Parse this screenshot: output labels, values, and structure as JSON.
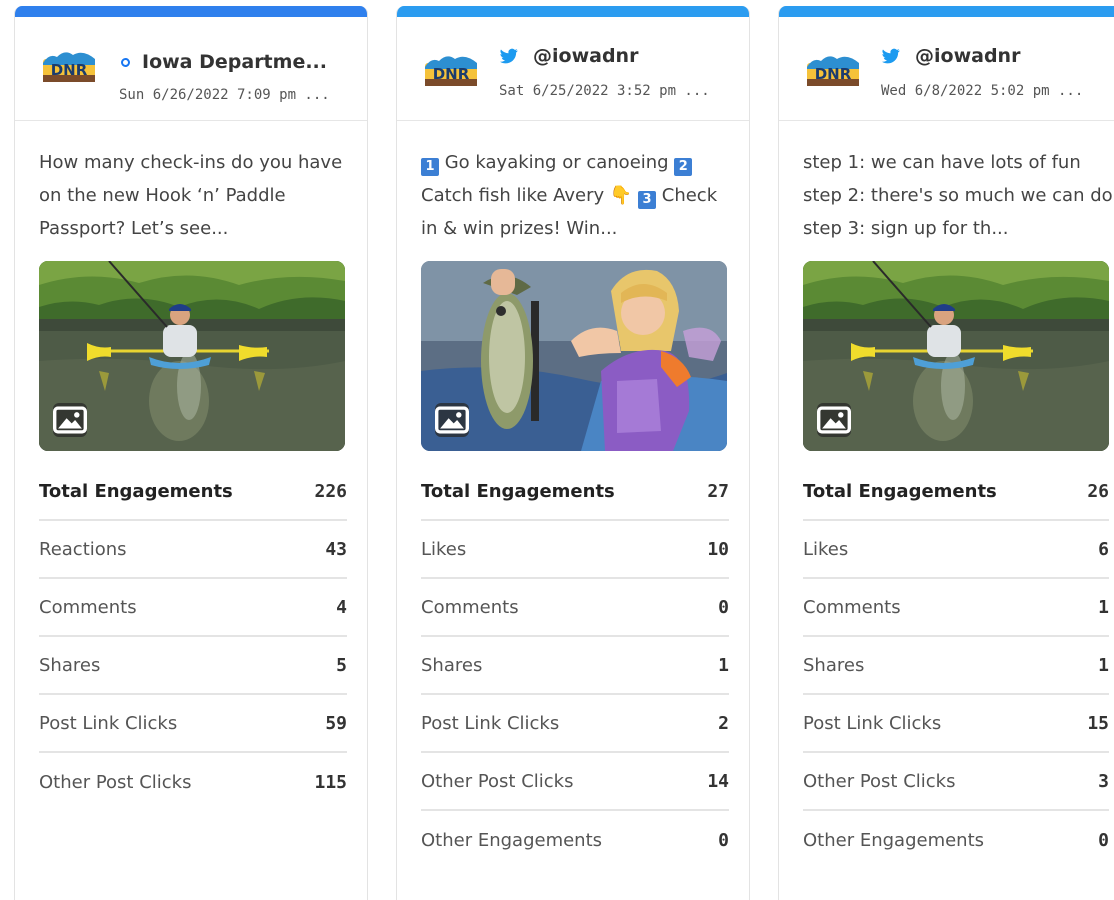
{
  "cards": [
    {
      "network": "facebook",
      "network_icon": "facebook-icon",
      "account": "Iowa Departme...",
      "timestamp": "Sun 6/26/2022 7:09 pm ...",
      "text": "How many check-ins do you have on the new Hook ‘n’ Paddle Passport? Let’s see...",
      "photo": "kayak-fishing-photo",
      "stats": [
        {
          "label": "Total Engagements",
          "value": "226"
        },
        {
          "label": "Reactions",
          "value": "43"
        },
        {
          "label": "Comments",
          "value": "4"
        },
        {
          "label": "Shares",
          "value": "5"
        },
        {
          "label": "Post Link Clicks",
          "value": "59"
        },
        {
          "label": "Other Post Clicks",
          "value": "115"
        }
      ]
    },
    {
      "network": "twitter",
      "network_icon": "twitter-bird-icon",
      "account": "@iowadnr",
      "timestamp": "Sat 6/25/2022 3:52 pm ...",
      "text_parts": {
        "badge1": "1",
        "seg1": " Go kayaking or canoeing ",
        "badge2": "2",
        "seg2": " Catch fish like Avery ",
        "emoji": "👇",
        "seg3": " ",
        "badge3": "3",
        "seg4": " Check in & win prizes! Win..."
      },
      "photo": "girl-holding-fish-photo",
      "stats": [
        {
          "label": "Total Engagements",
          "value": "27"
        },
        {
          "label": "Likes",
          "value": "10"
        },
        {
          "label": "Comments",
          "value": "0"
        },
        {
          "label": "Shares",
          "value": "1"
        },
        {
          "label": "Post Link Clicks",
          "value": "2"
        },
        {
          "label": "Other Post Clicks",
          "value": "14"
        },
        {
          "label": "Other Engagements",
          "value": "0"
        }
      ]
    },
    {
      "network": "twitter",
      "network_icon": "twitter-bird-icon",
      "account": "@iowadnr",
      "timestamp": "Wed 6/8/2022 5:02 pm ...",
      "text": "step 1: we can have lots of fun step 2: there's so much we can do step 3: sign up for th...",
      "photo": "kayak-fishing-photo",
      "stats": [
        {
          "label": "Total Engagements",
          "value": "26"
        },
        {
          "label": "Likes",
          "value": "6"
        },
        {
          "label": "Comments",
          "value": "1"
        },
        {
          "label": "Shares",
          "value": "1"
        },
        {
          "label": "Post Link Clicks",
          "value": "15"
        },
        {
          "label": "Other Post Clicks",
          "value": "3"
        },
        {
          "label": "Other Engagements",
          "value": "0"
        }
      ]
    }
  ],
  "colors": {
    "facebook_accent": "#2f80ed",
    "twitter_accent": "#2b9cf0",
    "twitter_blue": "#1d9bf0",
    "facebook_blue": "#1877f2",
    "number_badge": "#3c7fd4"
  }
}
